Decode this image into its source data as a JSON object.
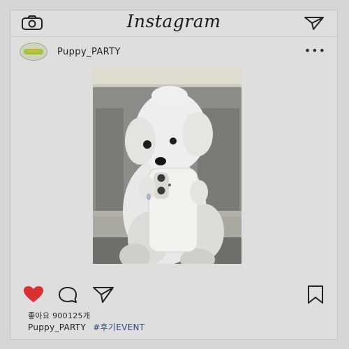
{
  "app": {
    "title": "Instagram"
  },
  "post": {
    "username": "Puppy_PARTY",
    "more_glyph": "•••",
    "likes_label": "좋아요",
    "likes_count": "900125개",
    "caption_user": "Puppy_PARTY",
    "caption_tag": "#후기EVENT"
  },
  "icons": {
    "camera": "camera-icon",
    "send": "send-icon",
    "heart": "heart-icon",
    "comment": "comment-icon",
    "share": "share-icon",
    "bookmark": "bookmark-icon"
  },
  "colors": {
    "heart_red": "#d8312f",
    "background": "#d6d6d6",
    "hashtag": "#2c4a7e"
  }
}
